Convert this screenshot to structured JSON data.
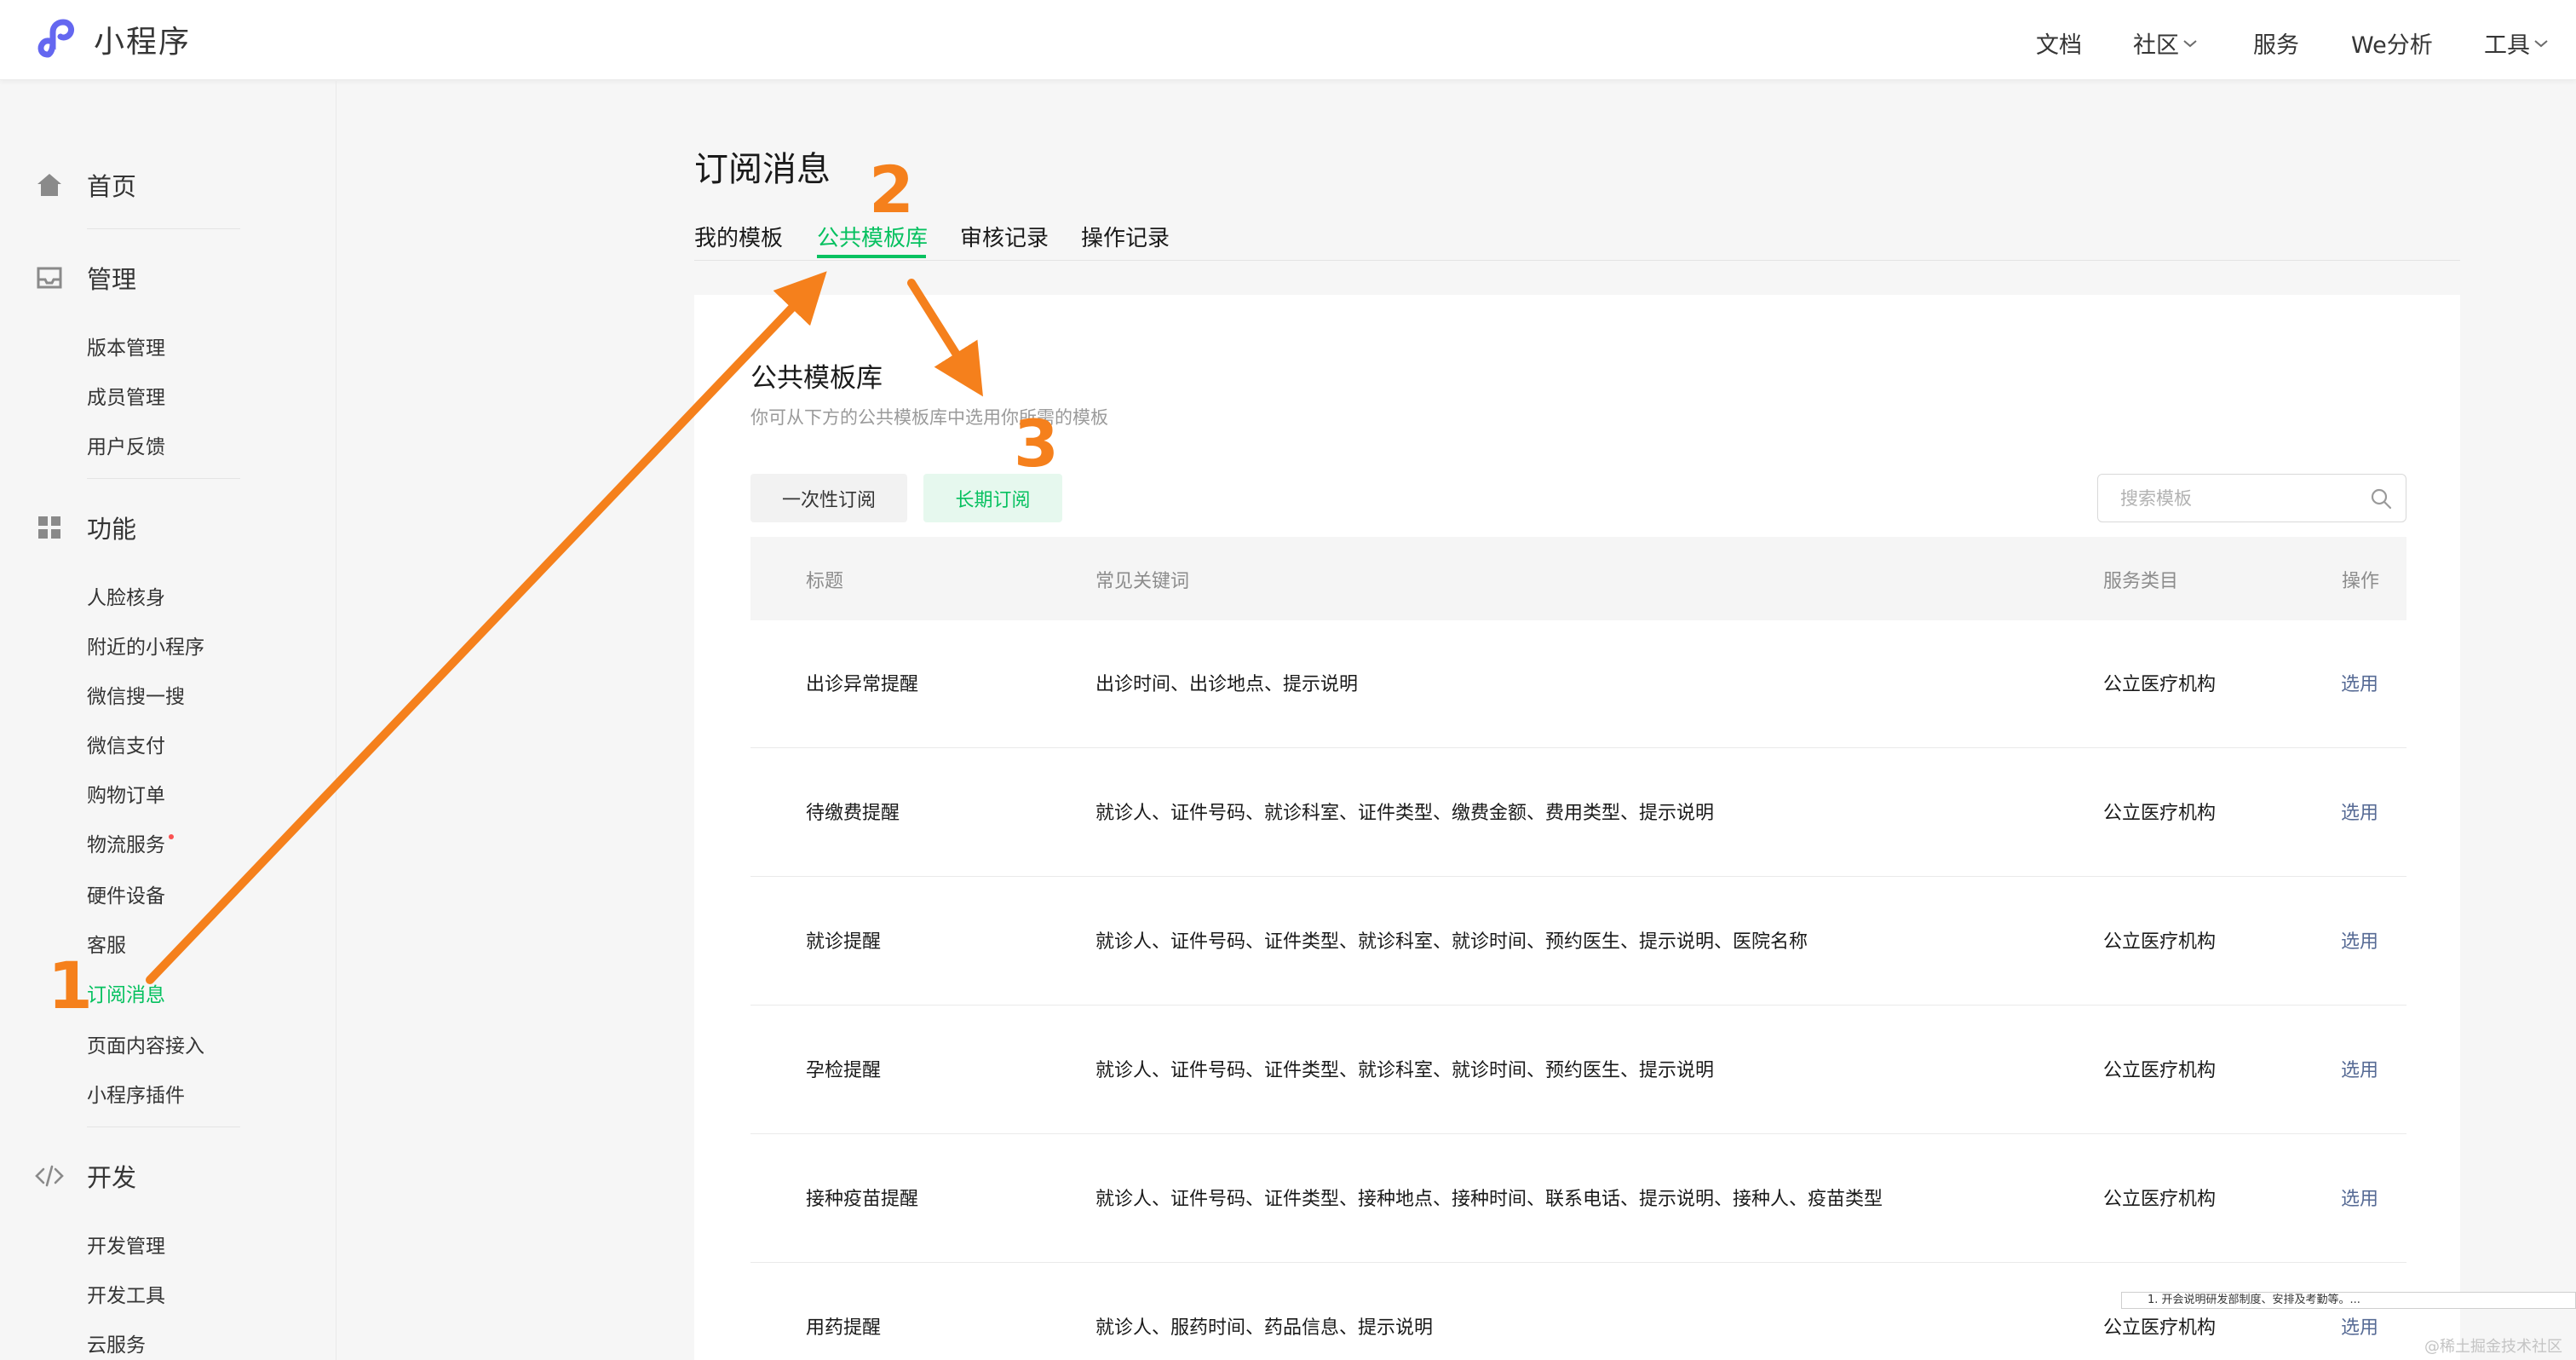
{
  "app": {
    "title": "小程序"
  },
  "topnav": [
    {
      "label": "文档",
      "has_dropdown": false
    },
    {
      "label": "社区",
      "has_dropdown": true
    },
    {
      "label": "服务",
      "has_dropdown": false
    },
    {
      "label": "We分析",
      "has_dropdown": false
    },
    {
      "label": "工具",
      "has_dropdown": true
    }
  ],
  "sidebar": {
    "home": "首页",
    "manage": {
      "title": "管理",
      "items": [
        "版本管理",
        "成员管理",
        "用户反馈"
      ]
    },
    "features": {
      "title": "功能",
      "items": [
        "人脸核身",
        "附近的小程序",
        "微信搜一搜",
        "微信支付",
        "购物订单",
        "物流服务",
        "硬件设备",
        "客服",
        "订阅消息",
        "页面内容接入",
        "小程序插件"
      ],
      "active": "订阅消息"
    },
    "dev": {
      "title": "开发",
      "items": [
        "开发管理",
        "开发工具",
        "云服务"
      ]
    }
  },
  "page": {
    "title": "订阅消息",
    "tabs": [
      "我的模板",
      "公共模板库",
      "审核记录",
      "操作记录"
    ],
    "active_tab": "公共模板库"
  },
  "library": {
    "title": "公共模板库",
    "description": "你可从下方的公共模板库中选用你所需的模板",
    "segments": [
      "一次性订阅",
      "长期订阅"
    ],
    "active_segment": "长期订阅",
    "search_placeholder": "搜索模板",
    "columns": [
      "标题",
      "常见关键词",
      "服务类目",
      "操作"
    ],
    "rows": [
      {
        "title": "出诊异常提醒",
        "keywords": "出诊时间、出诊地点、提示说明",
        "category": "公立医疗机构",
        "action": "选用"
      },
      {
        "title": "待缴费提醒",
        "keywords": "就诊人、证件号码、就诊科室、证件类型、缴费金额、费用类型、提示说明",
        "category": "公立医疗机构",
        "action": "选用"
      },
      {
        "title": "就诊提醒",
        "keywords": "就诊人、证件号码、证件类型、就诊科室、就诊时间、预约医生、提示说明、医院名称",
        "category": "公立医疗机构",
        "action": "选用"
      },
      {
        "title": "孕检提醒",
        "keywords": "就诊人、证件号码、证件类型、就诊科室、就诊时间、预约医生、提示说明",
        "category": "公立医疗机构",
        "action": "选用"
      },
      {
        "title": "接种疫苗提醒",
        "keywords": "就诊人、证件号码、证件类型、接种地点、接种时间、联系电话、提示说明、接种人、疫苗类型",
        "category": "公立医疗机构",
        "action": "选用"
      },
      {
        "title": "用药提醒",
        "keywords": "就诊人、服药时间、药品信息、提示说明",
        "category": "公立医疗机构",
        "action": "选用"
      }
    ]
  },
  "annotations": {
    "step1": "1",
    "step2": "2",
    "step3": "3",
    "color": "#f5801c"
  },
  "tooltip": "1. 开会说明研发部制度、安排及考勤等。...",
  "watermark": "@稀土掘金技术社区",
  "colors": {
    "accent": "#07c160",
    "link": "#576b95",
    "badge": "#fa5151"
  }
}
